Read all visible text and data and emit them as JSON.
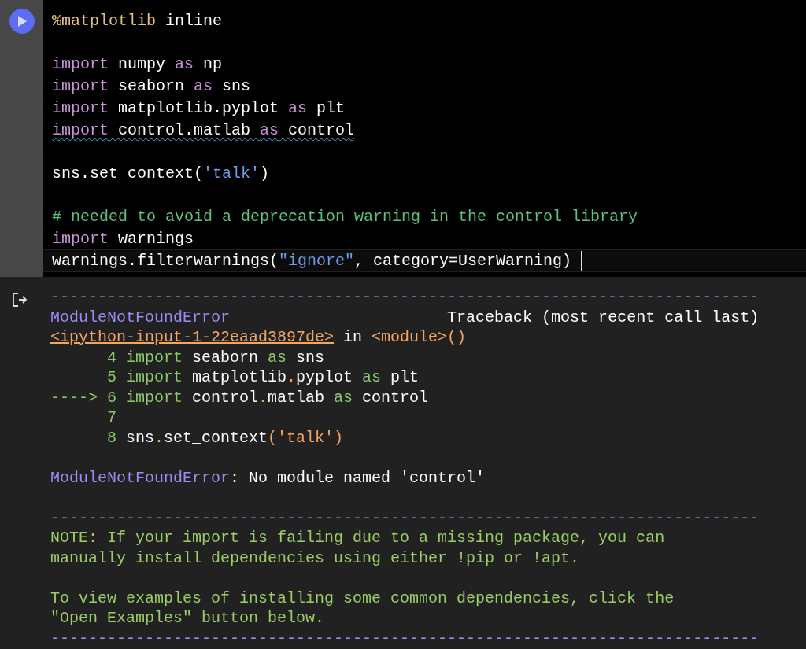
{
  "code_cell": {
    "blocks": [
      {
        "lines": [
          {
            "squiggle": false,
            "current": false,
            "tokens": [
              {
                "kind": "magic",
                "text": "%matplotlib"
              },
              {
                "kind": "plain",
                "text": " inline"
              }
            ]
          }
        ]
      },
      {
        "lines": [
          {
            "squiggle": false,
            "current": false,
            "tokens": [
              {
                "kind": "keyword",
                "text": "import"
              },
              {
                "kind": "plain",
                "text": " numpy "
              },
              {
                "kind": "keyword",
                "text": "as"
              },
              {
                "kind": "plain",
                "text": " np"
              }
            ]
          },
          {
            "squiggle": false,
            "current": false,
            "tokens": [
              {
                "kind": "keyword",
                "text": "import"
              },
              {
                "kind": "plain",
                "text": " seaborn "
              },
              {
                "kind": "keyword",
                "text": "as"
              },
              {
                "kind": "plain",
                "text": " sns"
              }
            ]
          },
          {
            "squiggle": false,
            "current": false,
            "tokens": [
              {
                "kind": "keyword",
                "text": "import"
              },
              {
                "kind": "plain",
                "text": " matplotlib.pyplot "
              },
              {
                "kind": "keyword",
                "text": "as"
              },
              {
                "kind": "plain",
                "text": " plt"
              }
            ]
          },
          {
            "squiggle": true,
            "current": false,
            "tokens": [
              {
                "kind": "keyword",
                "text": "import"
              },
              {
                "kind": "plain",
                "text": " control.matlab "
              },
              {
                "kind": "keyword",
                "text": "as"
              },
              {
                "kind": "plain",
                "text": " control"
              }
            ]
          }
        ]
      },
      {
        "lines": [
          {
            "squiggle": false,
            "current": false,
            "tokens": [
              {
                "kind": "plain",
                "text": "sns.set_context("
              },
              {
                "kind": "string",
                "text": "'talk'"
              },
              {
                "kind": "plain",
                "text": ")"
              }
            ]
          }
        ]
      },
      {
        "lines": [
          {
            "squiggle": false,
            "current": false,
            "tokens": [
              {
                "kind": "comment",
                "text": "# needed to avoid a deprecation warning in the control library"
              }
            ]
          },
          {
            "squiggle": false,
            "current": false,
            "tokens": [
              {
                "kind": "keyword",
                "text": "import"
              },
              {
                "kind": "plain",
                "text": " warnings"
              }
            ]
          },
          {
            "squiggle": false,
            "current": true,
            "tokens": [
              {
                "kind": "plain",
                "text": "warnings.filterwarnings("
              },
              {
                "kind": "string",
                "text": "\"ignore\""
              },
              {
                "kind": "plain",
                "text": ", category=UserWarning)"
              }
            ]
          }
        ]
      }
    ]
  },
  "output": {
    "blocks": [
      {
        "lines": [
          [
            {
              "kind": "rule",
              "text": "---------------------------------------------------------------------------"
            }
          ],
          [
            {
              "kind": "error",
              "text": "ModuleNotFoundError"
            },
            {
              "kind": "plain",
              "text": "                       Traceback (most recent call last)"
            }
          ],
          [
            {
              "kind": "link",
              "text": "<ipython-input-1-22eaad3897de>"
            },
            {
              "kind": "plain",
              "text": " in "
            },
            {
              "kind": "punct",
              "text": "<module>()"
            }
          ],
          [
            {
              "kind": "lineno",
              "text": "      4 "
            },
            {
              "kind": "keyword",
              "text": "import"
            },
            {
              "kind": "plain",
              "text": " seaborn "
            },
            {
              "kind": "keyword",
              "text": "as"
            },
            {
              "kind": "plain",
              "text": " sns"
            }
          ],
          [
            {
              "kind": "lineno",
              "text": "      5 "
            },
            {
              "kind": "keyword",
              "text": "import"
            },
            {
              "kind": "plain",
              "text": " matplotlib"
            },
            {
              "kind": "punct",
              "text": "."
            },
            {
              "kind": "plain",
              "text": "pyplot "
            },
            {
              "kind": "keyword",
              "text": "as"
            },
            {
              "kind": "plain",
              "text": " plt"
            }
          ],
          [
            {
              "kind": "lineno",
              "text": "----> 6 "
            },
            {
              "kind": "keyword",
              "text": "import"
            },
            {
              "kind": "plain",
              "text": " control"
            },
            {
              "kind": "punct",
              "text": "."
            },
            {
              "kind": "plain",
              "text": "matlab "
            },
            {
              "kind": "keyword",
              "text": "as"
            },
            {
              "kind": "plain",
              "text": " control"
            }
          ],
          [
            {
              "kind": "lineno",
              "text": "      7"
            }
          ],
          [
            {
              "kind": "lineno",
              "text": "      8 "
            },
            {
              "kind": "plain",
              "text": "sns"
            },
            {
              "kind": "punct",
              "text": "."
            },
            {
              "kind": "plain",
              "text": "set_context"
            },
            {
              "kind": "punct",
              "text": "('talk')"
            }
          ]
        ]
      },
      {
        "lines": [
          [
            {
              "kind": "error",
              "text": "ModuleNotFoundError"
            },
            {
              "kind": "plain",
              "text": ": No module named 'control'"
            }
          ]
        ]
      },
      {
        "lines": [
          [
            {
              "kind": "rule",
              "text": "---------------------------------------------------------------------------"
            }
          ],
          [
            {
              "kind": "note",
              "text": "NOTE: If your import is failing due to a missing package, you can"
            }
          ],
          [
            {
              "kind": "note",
              "text": "manually install dependencies using either !pip or !apt."
            }
          ]
        ]
      },
      {
        "lines": [
          [
            {
              "kind": "note",
              "text": "To view examples of installing some common dependencies, click the"
            }
          ],
          [
            {
              "kind": "note",
              "text": "\"Open Examples\" button below."
            }
          ],
          [
            {
              "kind": "rule",
              "text": "---------------------------------------------------------------------------"
            }
          ]
        ]
      }
    ]
  }
}
